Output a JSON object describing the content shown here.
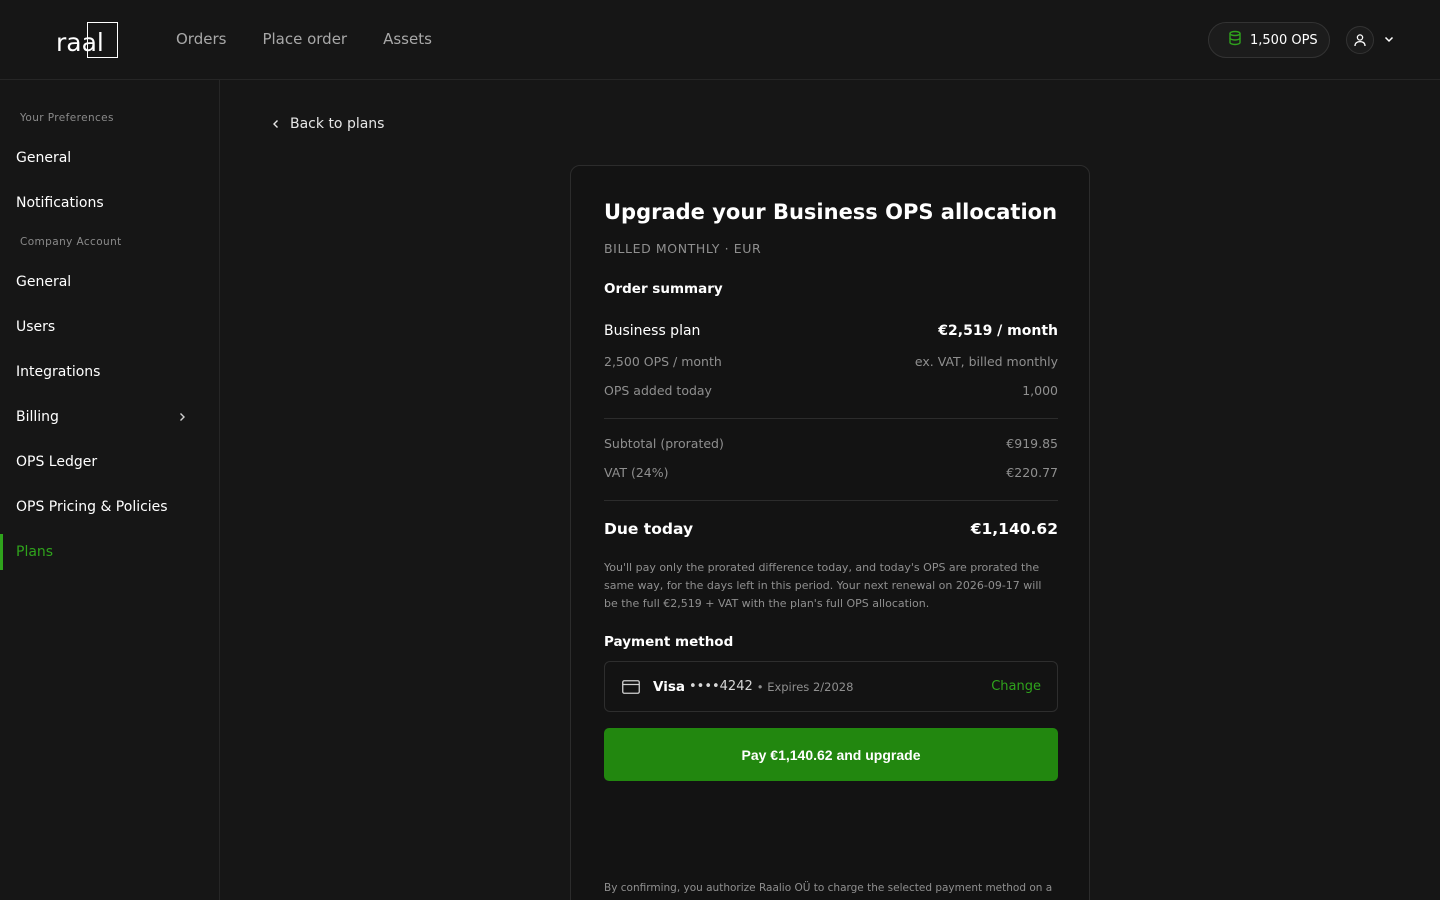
{
  "header": {
    "logo_text": "raal",
    "nav": [
      {
        "label": "Orders"
      },
      {
        "label": "Place order"
      },
      {
        "label": "Assets"
      }
    ],
    "ops_balance": "1,500 OPS"
  },
  "sidebar": {
    "section_preferences": "Your Preferences",
    "preferences_items": [
      {
        "label": "General"
      },
      {
        "label": "Notifications"
      }
    ],
    "section_company": "Company Account",
    "company_items": [
      {
        "label": "General"
      },
      {
        "label": "Users"
      },
      {
        "label": "Integrations"
      },
      {
        "label": "Billing"
      },
      {
        "label": "OPS Ledger"
      },
      {
        "label": "OPS Pricing & Policies"
      },
      {
        "label": "Plans"
      }
    ],
    "active_item": "Plans"
  },
  "main": {
    "back_link": "Back to plans",
    "card": {
      "title": "Upgrade your Business OPS allocation",
      "subtitle": "BILLED MONTHLY · EUR",
      "order_summary_heading": "Order summary",
      "plan_label": "Business plan",
      "plan_price": "€2,519 / month",
      "ops_per_month": "2,500 OPS / month",
      "billing_note": "ex. VAT, billed monthly",
      "ops_added_label": "OPS added today",
      "ops_added_value": "1,000",
      "subtotal_label": "Subtotal (prorated)",
      "subtotal_value": "€919.85",
      "vat_label": "VAT (24%)",
      "vat_value": "€220.77",
      "due_label": "Due today",
      "due_value": "€1,140.62",
      "prorate_note": "You'll pay only the prorated difference today, and today's OPS are prorated the same way, for the days left in this period. Your next renewal on 2026-09-17 will be the full €2,519 + VAT with the plan's full OPS allocation.",
      "payment_method_heading": "Payment method",
      "card_brand": "Visa",
      "card_digits": "••••4242",
      "card_expiry": "• Expires 2/2028",
      "change_label": "Change",
      "pay_button_label": "Pay €1,140.62 and upgrade",
      "legal_text": "By confirming, you authorize Raalio OÜ to charge the selected payment method on a"
    }
  },
  "colors": {
    "background": "#161616",
    "accent": "#2fa31c",
    "button": "#22870f"
  }
}
